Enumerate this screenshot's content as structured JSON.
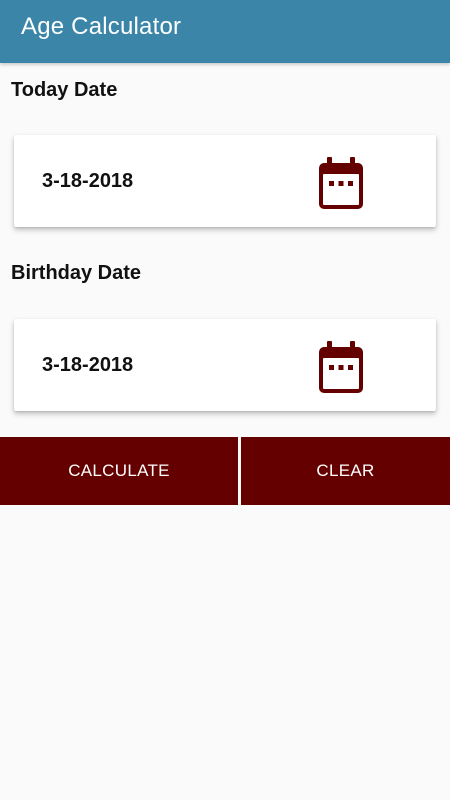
{
  "app_bar": {
    "title": "Age Calculator",
    "color": "#3b86a8"
  },
  "today": {
    "label": "Today Date",
    "value": "3-18-2018",
    "icon": "calendar-icon"
  },
  "birthday": {
    "label": "Birthday Date",
    "value": "3-18-2018",
    "icon": "calendar-icon"
  },
  "actions": {
    "calculate_label": "CALCULATE",
    "clear_label": "CLEAR",
    "button_color": "#650000"
  },
  "colors": {
    "icon": "#650000",
    "background": "#fafafa"
  }
}
